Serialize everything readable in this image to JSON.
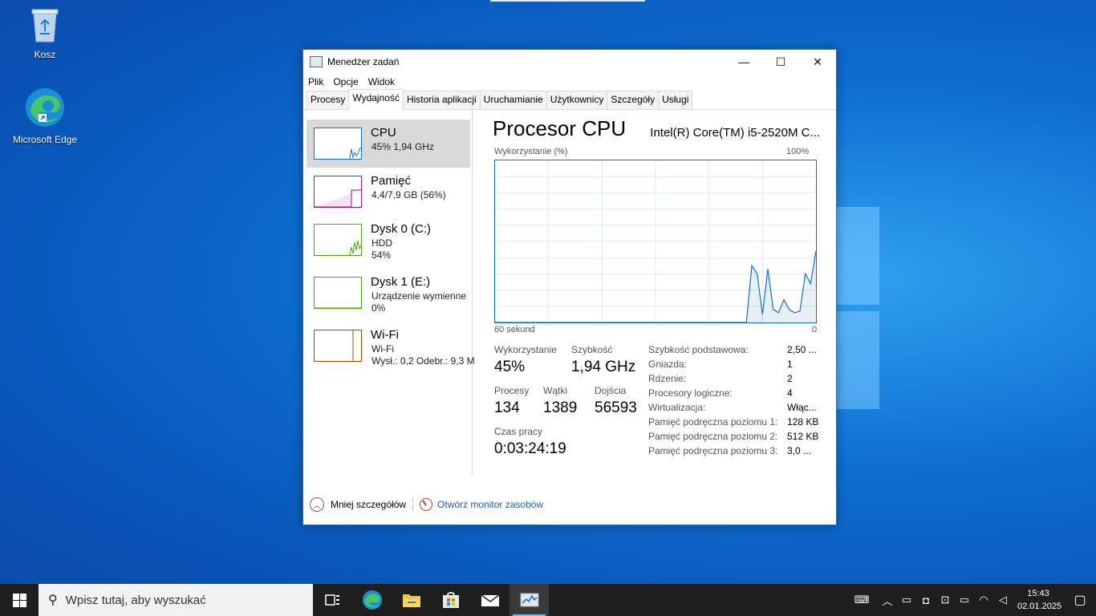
{
  "desktop": {
    "icons": [
      {
        "label": "Kosz",
        "icon": "recycle-bin-icon"
      },
      {
        "label": "Microsoft Edge",
        "icon": "edge-icon"
      }
    ]
  },
  "window": {
    "title": "Menedżer zadań",
    "controls": {
      "minimize": "—",
      "maximize": "☐",
      "close": "✕"
    },
    "menu": [
      "Plik",
      "Opcje",
      "Widok"
    ],
    "tabs": [
      "Procesy",
      "Wydajność",
      "Historia aplikacji",
      "Uruchamianie",
      "Użytkownicy",
      "Szczegóły",
      "Usługi"
    ],
    "active_tab": "Wydajność"
  },
  "sidebar": {
    "items": [
      {
        "title": "CPU",
        "line1": "45% 1,94 GHz",
        "line2": "",
        "color": "#1170c4"
      },
      {
        "title": "Pamięć",
        "line1": "4,4/7,9 GB (56%)",
        "line2": "",
        "color": "#8b1a8b"
      },
      {
        "title": "Dysk 0 (C:)",
        "line1": "HDD",
        "line2": "54%",
        "color": "#4da60c"
      },
      {
        "title": "Dysk 1 (E:)",
        "line1": "Urządzenie wymienne",
        "line2": "0%",
        "color": "#4da60c"
      },
      {
        "title": "Wi-Fi",
        "line1": "Wi-Fi",
        "line2": "Wysł.: 0,2  Odebr.: 9,3 M",
        "color": "#a74f01"
      }
    ]
  },
  "cpu": {
    "heading": "Procesor CPU",
    "model": "Intel(R) Core(TM) i5-2520M C...",
    "graph_label": "Wykorzystanie (%)",
    "graph_max": "100%",
    "axis_left": "60 sekund",
    "axis_right": "0",
    "usage_series": [
      0,
      0,
      0,
      0,
      0,
      0,
      0,
      0,
      0,
      0,
      0,
      0,
      0,
      0,
      0,
      0,
      0,
      0,
      0,
      0,
      0,
      0,
      0,
      0,
      0,
      0,
      0,
      0,
      0,
      0,
      0,
      0,
      0,
      0,
      0,
      0,
      0,
      0,
      0,
      0,
      0,
      0,
      0,
      0,
      0,
      0,
      0,
      0,
      35,
      30,
      5,
      33,
      8,
      6,
      14,
      8,
      6,
      7,
      30,
      24,
      44
    ],
    "stats": {
      "usage_label": "Wykorzystanie",
      "usage": "45%",
      "speed_label": "Szybkość",
      "speed": "1,94 GHz",
      "procs_label": "Procesy",
      "procs": "134",
      "threads_label": "Wątki",
      "threads": "1389",
      "handles_label": "Dojścia",
      "handles": "56593",
      "uptime_label": "Czas pracy",
      "uptime": "0:03:24:19"
    },
    "specs": [
      {
        "k": "Szybkość podstawowa:",
        "v": "2,50 ..."
      },
      {
        "k": "Gniazda:",
        "v": "1"
      },
      {
        "k": "Rdzenie:",
        "v": "2"
      },
      {
        "k": "Procesory logiczne:",
        "v": "4"
      },
      {
        "k": "Wirtualizacja:",
        "v": "Włąc..."
      },
      {
        "k": "Pamięć podręczna poziomu 1:",
        "v": "128 KB"
      },
      {
        "k": "Pamięć podręczna poziomu 2:",
        "v": "512 KB"
      },
      {
        "k": "Pamięć podręczna poziomu 3:",
        "v": "3,0 ..."
      }
    ]
  },
  "footer": {
    "less_details": "Mniej szczegółów",
    "resource_monitor": "Otwórz monitor zasobów"
  },
  "taskbar": {
    "search_placeholder": "Wpisz tutaj, aby wyszukać",
    "time": "15:43",
    "date": "02.01.2025"
  }
}
